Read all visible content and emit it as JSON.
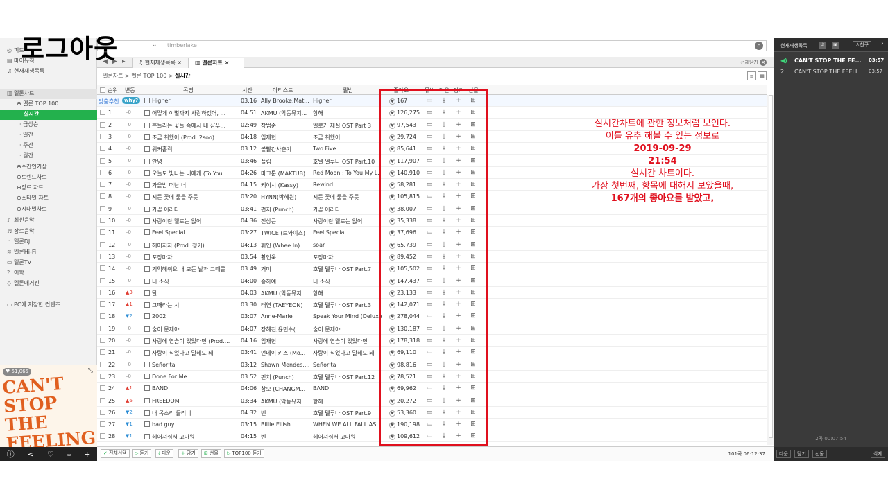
{
  "overlay_title": "로그아웃",
  "sidebar": {
    "items": [
      {
        "icon": "chat-icon",
        "glyph": "◎",
        "label": "피드"
      },
      {
        "icon": "music-box-icon",
        "glyph": "▤",
        "label": "마이뮤직"
      },
      {
        "icon": "playlist-icon",
        "glyph": "♫",
        "label": "현재재생목록"
      }
    ],
    "chart_label": "멜론차트",
    "sub_items": [
      "멜론 TOP 100",
      "실시간",
      "급상승",
      "일간",
      "주간",
      "월간",
      "주간인기상",
      "트렌드차트",
      "장르 차트",
      "스타일 차트",
      "시대별차트"
    ],
    "more_items": [
      {
        "icon": "note-icon",
        "glyph": "♪",
        "label": "최신음악"
      },
      {
        "icon": "genre-icon",
        "glyph": "♬",
        "label": "장르음악"
      },
      {
        "icon": "headphone-icon",
        "glyph": "∩",
        "label": "멜론DJ"
      },
      {
        "icon": "hifi-icon",
        "glyph": "≋",
        "label": "멜론Hi-Fi"
      },
      {
        "icon": "tv-icon",
        "glyph": "▭",
        "label": "멜론TV"
      },
      {
        "icon": "question-icon",
        "glyph": "?",
        "label": "어학"
      },
      {
        "icon": "magazine-icon",
        "glyph": "◇",
        "label": "멜론매거진"
      }
    ],
    "pc_saved": "PC에 저장한 컨텐츠",
    "like_count": "♥ 51,065",
    "cover_text": "CAN'T STOP THE FEELING!"
  },
  "search": {
    "value": "timberlake"
  },
  "tabs": [
    {
      "label": "현재재생목록",
      "close": "×"
    },
    {
      "label": "멜론차트",
      "close": "×"
    }
  ],
  "close_all": "전체닫기",
  "breadcrumb": {
    "path": "멜론차트 > 멜론 TOP 100 > ",
    "current": "실시간"
  },
  "columns": [
    "순위",
    "변동",
    "곡명",
    "시간",
    "아티스트",
    "앨범",
    "좋아요",
    "뮤비",
    "다운",
    "담기",
    "선물"
  ],
  "recommend": {
    "label": "맞춤추천",
    "badge": "why?",
    "song": "Higher",
    "time": "03:16",
    "artist": "Ally Brooke,Mat...",
    "album": "Higher",
    "likes": "167"
  },
  "rows": [
    {
      "rank": "1",
      "change": "–0",
      "dir": "eq",
      "song": "어떻게 이별까지 사랑하겠어, ...",
      "time": "04:51",
      "artist": "AKMU (악동뮤지...",
      "album": "항해",
      "likes": "126,275"
    },
    {
      "rank": "2",
      "change": "–0",
      "dir": "eq",
      "song": "흔들리는 꽃들 속에서 네 샴푸...",
      "time": "02:49",
      "artist": "장범준",
      "album": "멜로가 체질 OST Part 3",
      "likes": "97,543"
    },
    {
      "rank": "3",
      "change": "–0",
      "dir": "eq",
      "song": "조금 취했어 (Prod. 2soo)",
      "time": "04:18",
      "artist": "임재현",
      "album": "조금 취했어",
      "likes": "29,724"
    },
    {
      "rank": "4",
      "change": "–0",
      "dir": "eq",
      "song": "워커홀릭",
      "time": "03:12",
      "artist": "볼빨간사춘기",
      "album": "Two Five",
      "likes": "85,641"
    },
    {
      "rank": "5",
      "change": "–0",
      "dir": "eq",
      "song": "안녕",
      "time": "03:46",
      "artist": "폴킴",
      "album": "호텔 델루나 OST Part.10",
      "likes": "117,907"
    },
    {
      "rank": "6",
      "change": "–0",
      "dir": "eq",
      "song": "오늘도 빛나는 너에게 (To You...",
      "time": "04:26",
      "artist": "마크툽 (MAKTUB)",
      "album": "Red Moon : To You My L...",
      "likes": "140,910"
    },
    {
      "rank": "7",
      "change": "–0",
      "dir": "eq",
      "song": "가을밤 떠난 너",
      "time": "04:15",
      "artist": "케이시 (Kassy)",
      "album": "Rewind",
      "likes": "58,281"
    },
    {
      "rank": "8",
      "change": "–0",
      "dir": "eq",
      "song": "시든 꽃에 물을 주듯",
      "time": "03:20",
      "artist": "HYNN(박혜원)",
      "album": "시든 꽃에 물을 주듯",
      "likes": "105,815"
    },
    {
      "rank": "9",
      "change": "–0",
      "dir": "eq",
      "song": "가끔 이러다",
      "time": "03:41",
      "artist": "펀치 (Punch)",
      "album": "가끔 이러다",
      "likes": "38,007"
    },
    {
      "rank": "10",
      "change": "–0",
      "dir": "eq",
      "song": "사랑이란 멜로는 없어",
      "time": "04:36",
      "artist": "전상근",
      "album": "사랑이란 멜로는 없어",
      "likes": "35,338"
    },
    {
      "rank": "11",
      "change": "–0",
      "dir": "eq",
      "song": "Feel Special",
      "time": "03:27",
      "artist": "TWICE (트와이스)",
      "album": "Feel Special",
      "likes": "37,696"
    },
    {
      "rank": "12",
      "change": "–0",
      "dir": "eq",
      "song": "헤어지자 (Prod. 정키)",
      "time": "04:13",
      "artist": "휘인 (Whee In)",
      "album": "soar",
      "likes": "65,739"
    },
    {
      "rank": "13",
      "change": "–0",
      "dir": "eq",
      "song": "포장마차",
      "time": "03:54",
      "artist": "황인욱",
      "album": "포장마차",
      "likes": "89,452"
    },
    {
      "rank": "14",
      "change": "–0",
      "dir": "eq",
      "song": "기억해줘요 내 모든 날과 그때를",
      "time": "03:49",
      "artist": "거미",
      "album": "호텔 델루나 OST Part.7",
      "likes": "105,502"
    },
    {
      "rank": "15",
      "change": "–0",
      "dir": "eq",
      "song": "니 소식",
      "time": "04:00",
      "artist": "송하예",
      "album": "니 소식",
      "likes": "147,437"
    },
    {
      "rank": "16",
      "change": "▲3",
      "dir": "up",
      "song": "달",
      "time": "04:03",
      "artist": "AKMU (악동뮤지...",
      "album": "항해",
      "likes": "23,133"
    },
    {
      "rank": "17",
      "change": "▲1",
      "dir": "up",
      "song": "그때라는 시",
      "time": "03:30",
      "artist": "태연 (TAEYEON)",
      "album": "호텔 델루나 OST Part.3",
      "likes": "142,071"
    },
    {
      "rank": "18",
      "change": "▼2",
      "dir": "dn",
      "song": "2002",
      "time": "03:07",
      "artist": "Anne-Marie",
      "album": "Speak Your Mind (Deluxe)",
      "likes": "278,044"
    },
    {
      "rank": "19",
      "change": "–0",
      "dir": "eq",
      "song": "술이 문제야",
      "time": "04:07",
      "artist": "장혜진,윤민수(...",
      "album": "술이 문제야",
      "likes": "130,187"
    },
    {
      "rank": "20",
      "change": "–0",
      "dir": "eq",
      "song": "사랑에 연습이 있었다면 (Prod....",
      "time": "04:16",
      "artist": "임재현",
      "album": "사랑에 연습이 있었다면",
      "likes": "178,318"
    },
    {
      "rank": "21",
      "change": "–0",
      "dir": "eq",
      "song": "사랑이 식었다고 말해도 돼",
      "time": "03:41",
      "artist": "먼데이 키즈 (Mo...",
      "album": "사랑이 식었다고 말해도 돼",
      "likes": "69,110"
    },
    {
      "rank": "22",
      "change": "–0",
      "dir": "eq",
      "song": "Señorita",
      "time": "03:12",
      "artist": "Shawn Mendes,...",
      "album": "Señorita",
      "likes": "98,816"
    },
    {
      "rank": "23",
      "change": "–0",
      "dir": "eq",
      "song": "Done For Me",
      "time": "03:52",
      "artist": "펀치 (Punch)",
      "album": "호텔 델루나 OST Part.12",
      "likes": "78,521"
    },
    {
      "rank": "24",
      "change": "▲1",
      "dir": "up",
      "song": "BAND",
      "time": "04:06",
      "artist": "창모 (CHANGM...",
      "album": "BAND",
      "likes": "69,962"
    },
    {
      "rank": "25",
      "change": "▲6",
      "dir": "up",
      "song": "FREEDOM",
      "time": "03:34",
      "artist": "AKMU (악동뮤지...",
      "album": "항해",
      "likes": "20,272"
    },
    {
      "rank": "26",
      "change": "▼2",
      "dir": "dn",
      "song": "내 목소리 들리니",
      "time": "04:32",
      "artist": "벤",
      "album": "호텔 델루나 OST Part.9",
      "likes": "53,360"
    },
    {
      "rank": "27",
      "change": "▼1",
      "dir": "dn",
      "song": "bad guy",
      "time": "03:15",
      "artist": "Billie Eilish",
      "album": "WHEN WE ALL FALL ASL...",
      "likes": "190,198"
    },
    {
      "rank": "28",
      "change": "▼1",
      "dir": "dn",
      "song": "헤어져줘서 고마워",
      "time": "04:15",
      "artist": "벤",
      "album": "헤어져줘서 고마워",
      "likes": "109,612"
    }
  ],
  "bottom": {
    "buttons": [
      "전체선택",
      "듣기",
      "다운",
      "담기",
      "선물",
      "TOP100 듣기"
    ],
    "status": "101곡 06:12:37"
  },
  "annotation": {
    "line1": "실시간차트에 관한 정보처럼 보인다.",
    "line2": "이를 유추 해볼 수 있는 정보로",
    "date": "2019-09-29",
    "time": "21:54",
    "line3": "실시간 차트이다.",
    "line4": "가장 첫번째, 항목에 대해서 보았을때,",
    "line5": "167개의 좋아요를 받았고,"
  },
  "right_panel": {
    "title": "현재재생목록",
    "friend": "친구",
    "items": [
      {
        "n": "◀)",
        "song": "CAN'T STOP THE FE...",
        "time": "03:57"
      },
      {
        "n": "2",
        "song": "CAN'T STOP THE FEELI...",
        "time": "03:57"
      }
    ],
    "total": "2곡 00:07:54",
    "footer": [
      "다운",
      "담기",
      "선물",
      "삭제"
    ]
  },
  "colors": {
    "accent": "#23b14d",
    "annotation_red": "#e0101e"
  }
}
